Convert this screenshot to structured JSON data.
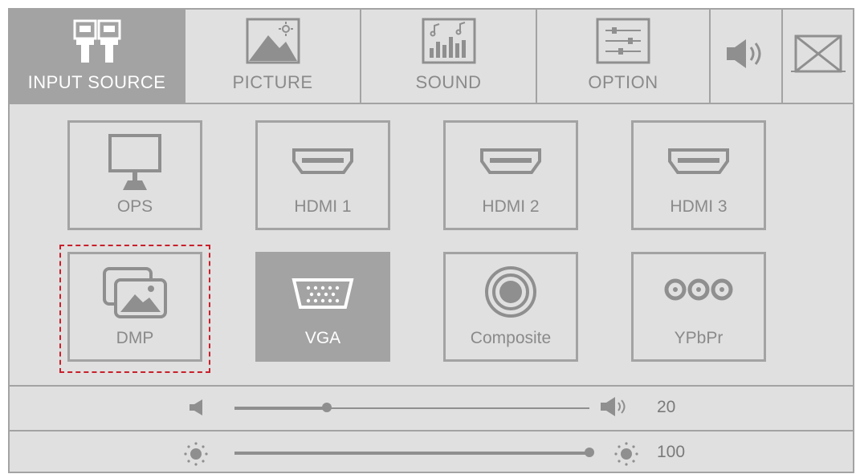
{
  "tabs": [
    {
      "label": "INPUT SOURCE",
      "icon": "input-source-icon",
      "active": true
    },
    {
      "label": "PICTURE",
      "icon": "picture-icon",
      "active": false
    },
    {
      "label": "SOUND",
      "icon": "sound-icon",
      "active": false
    },
    {
      "label": "OPTION",
      "icon": "option-icon",
      "active": false
    }
  ],
  "toolbar": {
    "speaker_icon": "speaker-icon",
    "close_icon": "close-icon"
  },
  "sources": [
    {
      "label": "OPS",
      "icon": "monitor-icon",
      "selected": false,
      "focused": false
    },
    {
      "label": "HDMI 1",
      "icon": "hdmi-icon",
      "selected": false,
      "focused": false
    },
    {
      "label": "HDMI 2",
      "icon": "hdmi-icon",
      "selected": false,
      "focused": false
    },
    {
      "label": "HDMI 3",
      "icon": "hdmi-icon",
      "selected": false,
      "focused": false
    },
    {
      "label": "DMP",
      "icon": "gallery-icon",
      "selected": false,
      "focused": true
    },
    {
      "label": "VGA",
      "icon": "vga-icon",
      "selected": true,
      "focused": false
    },
    {
      "label": "Composite",
      "icon": "composite-icon",
      "selected": false,
      "focused": false
    },
    {
      "label": "YPbPr",
      "icon": "ypbpr-icon",
      "selected": false,
      "focused": false
    }
  ],
  "volume": {
    "value": "20",
    "level": 0.26
  },
  "brightness": {
    "value": "100",
    "level": 1.0
  },
  "colors": {
    "background": "#e0e0e0",
    "border": "#a3a3a3",
    "selected": "#a3a3a3",
    "text": "#8a8a8a",
    "focus": "#c8202b"
  }
}
